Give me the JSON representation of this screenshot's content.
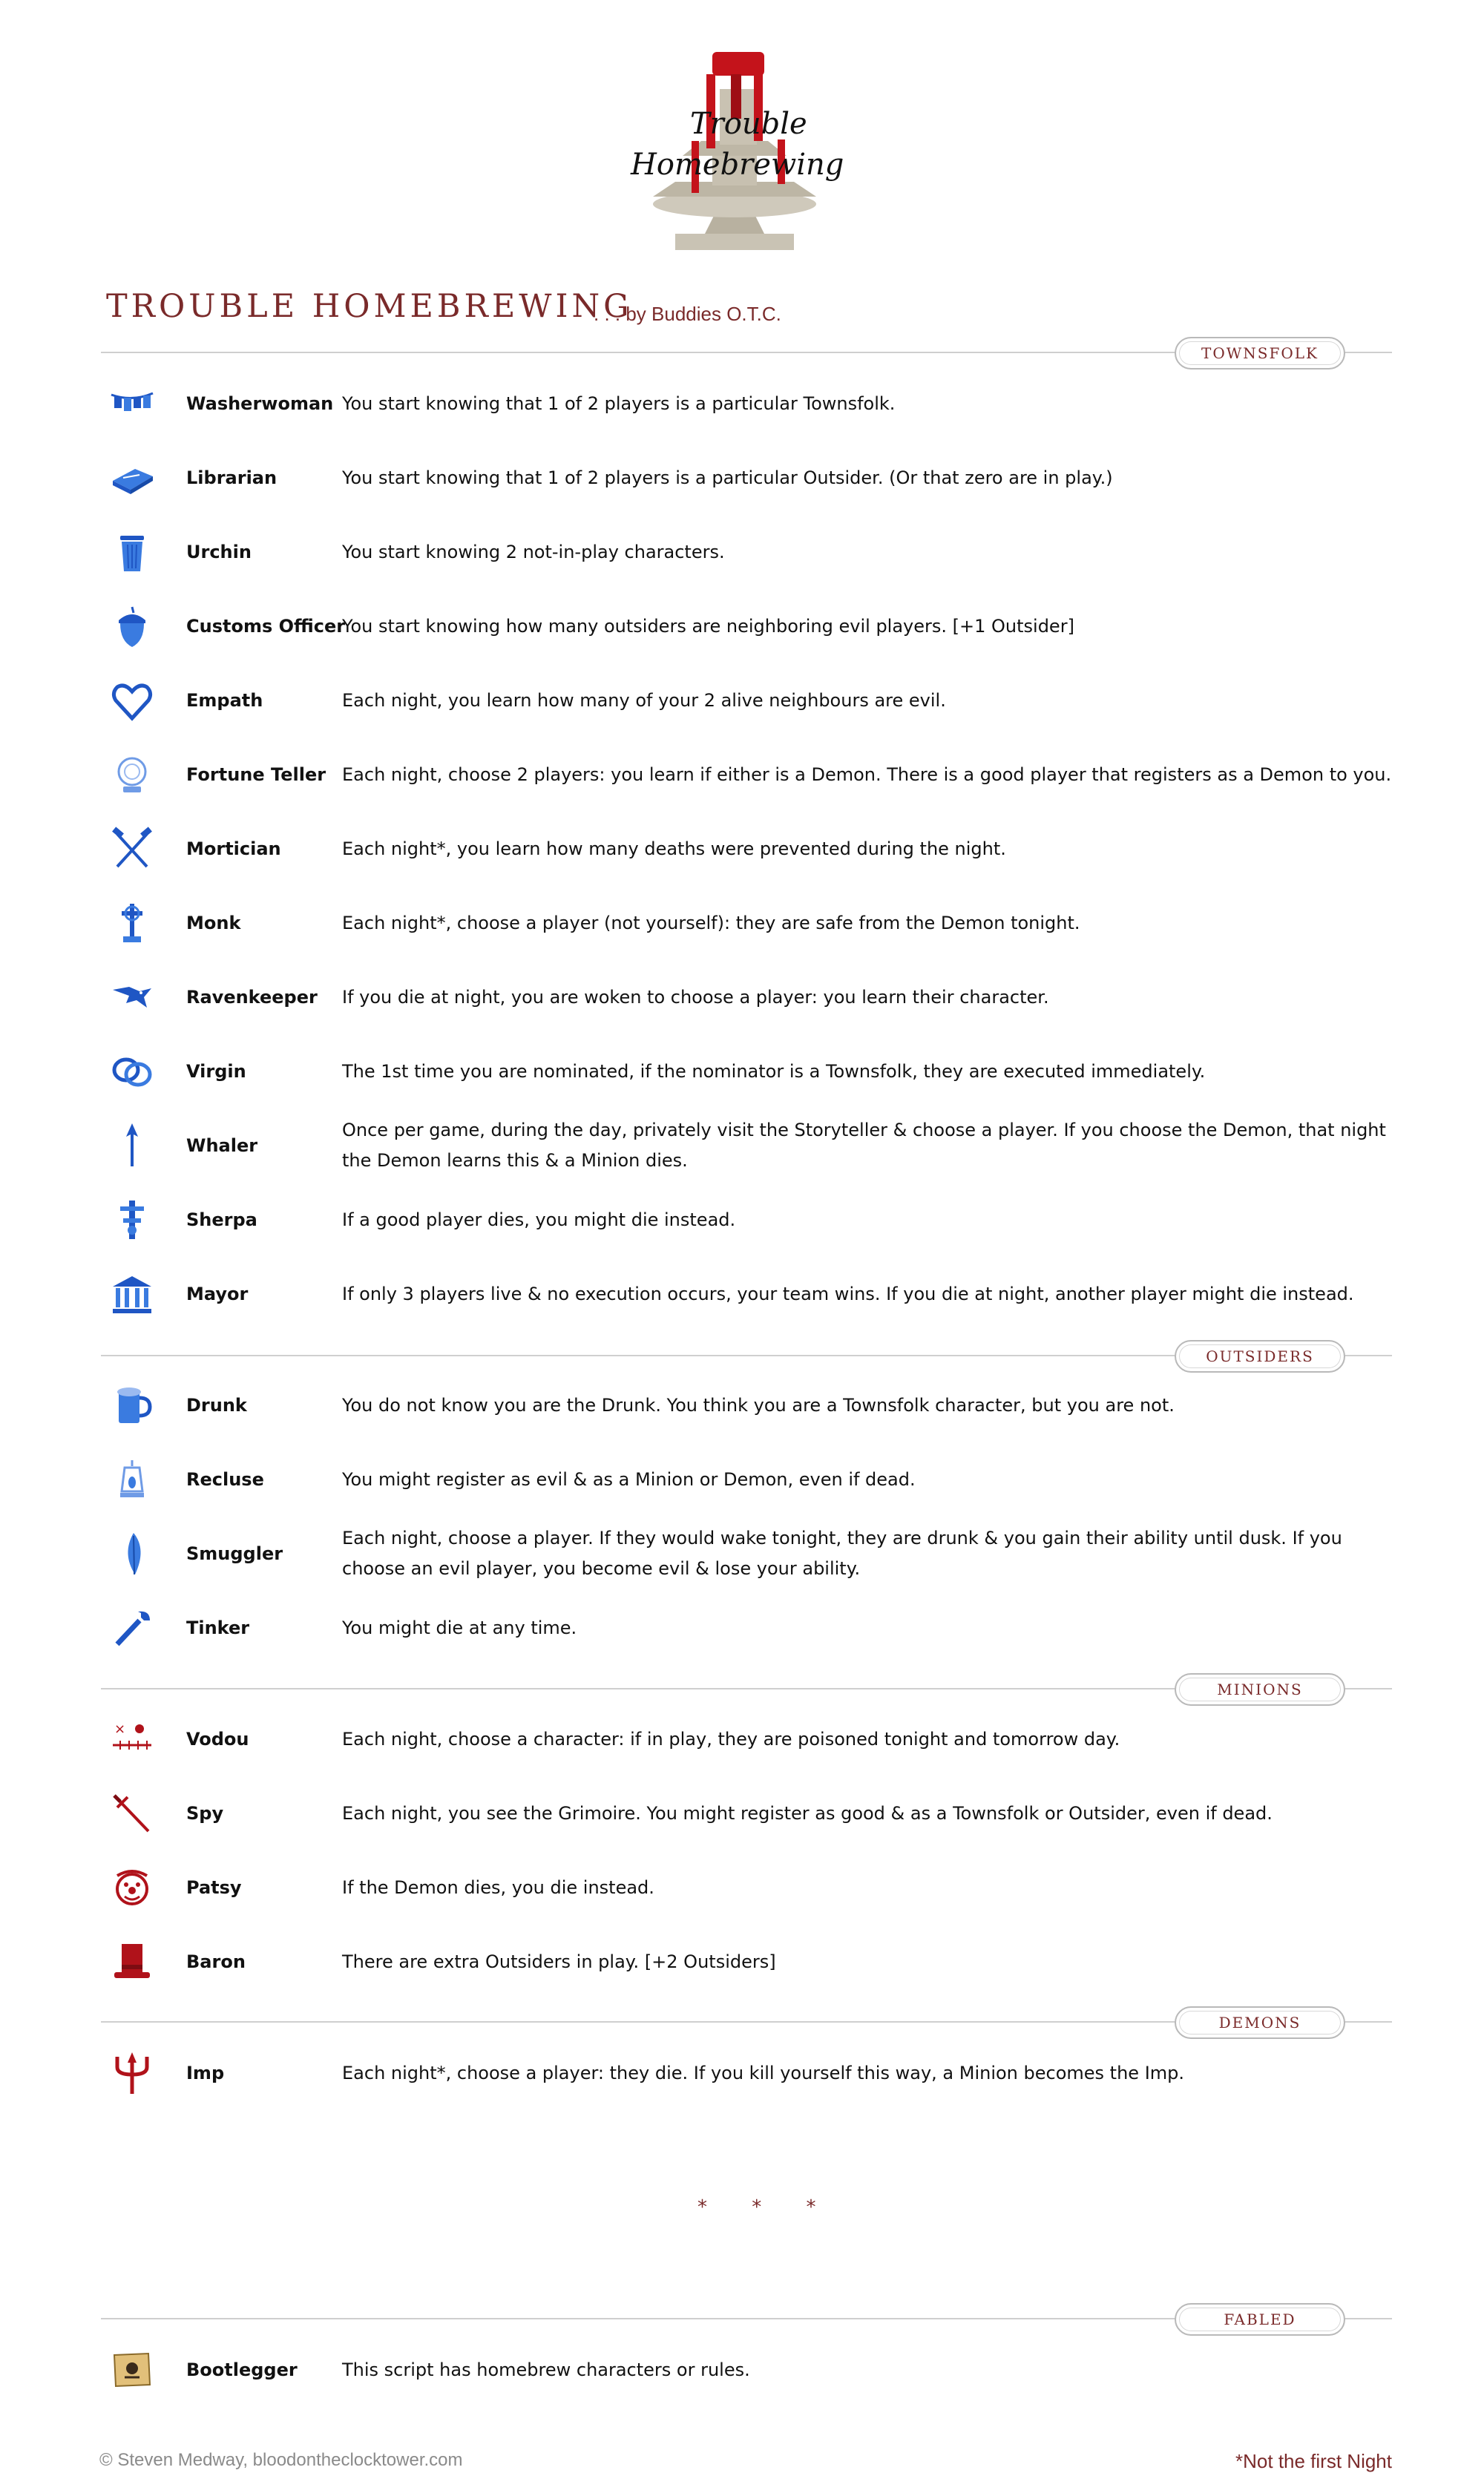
{
  "header": {
    "title": "Trouble Homebrewing",
    "author": ". . . by Buddies O.T.C.",
    "logo_text_line1": "Trouble",
    "logo_text_line2": "Homebrewing"
  },
  "colors": {
    "accent": "#7a2a2a",
    "good_icon": "#1f56c4",
    "evil_icon": "#b0121a"
  },
  "sections": {
    "townsfolk": "Townsfolk",
    "outsiders": "Outsiders",
    "minions": "Minions",
    "demons": "Demons",
    "fabled": "Fabled"
  },
  "townsfolk": [
    {
      "name": "Washerwoman",
      "icon": "clothesline-icon",
      "ability": "You start knowing that 1 of 2 players is a particular Townsfolk."
    },
    {
      "name": "Librarian",
      "icon": "book-icon",
      "ability": "You start knowing that 1 of 2 players is a particular Outsider. (Or that zero are in play.)"
    },
    {
      "name": "Urchin",
      "icon": "trash-can-icon",
      "ability": "You start knowing 2 not-in-play characters."
    },
    {
      "name": "Customs Officer",
      "icon": "acorn-icon",
      "ability": "You start knowing how many outsiders are neighboring evil players. [+1 Outsider]"
    },
    {
      "name": "Empath",
      "icon": "heart-icon",
      "ability": "Each night, you learn how many of your 2 alive neighbours are evil."
    },
    {
      "name": "Fortune Teller",
      "icon": "crystal-ball-icon",
      "ability": "Each night, choose 2 players: you learn if either is a Demon. There is a good player that registers as a Demon to you."
    },
    {
      "name": "Mortician",
      "icon": "crossed-tools-icon",
      "ability": "Each night*, you learn how many deaths were prevented during the night."
    },
    {
      "name": "Monk",
      "icon": "celtic-cross-icon",
      "ability": "Each night*, choose a player (not yourself): they are safe from the Demon tonight."
    },
    {
      "name": "Ravenkeeper",
      "icon": "raven-icon",
      "ability": "If you die at night, you are woken to choose a player: you learn their character."
    },
    {
      "name": "Virgin",
      "icon": "rings-icon",
      "ability": "The 1st time you are nominated, if the nominator is a Townsfolk, they are executed immediately."
    },
    {
      "name": "Whaler",
      "icon": "harpoon-icon",
      "ability": "Once per game, during the day, privately visit the Storyteller & choose a player. If you choose the Demon, that night the Demon learns this & a Minion dies."
    },
    {
      "name": "Sherpa",
      "icon": "totem-icon",
      "ability": "If a good player dies, you might die instead."
    },
    {
      "name": "Mayor",
      "icon": "town-hall-icon",
      "ability": "If only 3 players live & no execution occurs, your team wins. If you die at night, another player might die instead."
    }
  ],
  "outsiders": [
    {
      "name": "Drunk",
      "icon": "tankard-icon",
      "ability": "You do not know you are the Drunk. You think you are a Townsfolk character, but you are not."
    },
    {
      "name": "Recluse",
      "icon": "lantern-icon",
      "ability": "You might register as evil & as a Minion or Demon, even if dead."
    },
    {
      "name": "Smuggler",
      "icon": "feather-icon",
      "ability": "Each night, choose a player. If they would wake tonight, they are drunk & you gain their ability until dusk. If you choose an evil player, you become evil & lose your ability."
    },
    {
      "name": "Tinker",
      "icon": "wrench-icon",
      "ability": "You might die at any time."
    }
  ],
  "minions": [
    {
      "name": "Vodou",
      "icon": "voodoo-doll-icon",
      "ability": "Each night, choose a character: if in play, they are poisoned tonight and tomorrow day."
    },
    {
      "name": "Spy",
      "icon": "dagger-icon",
      "ability": "Each night, you see the Grimoire. You might register as good & as a Townsfolk or Outsider, even if dead."
    },
    {
      "name": "Patsy",
      "icon": "clown-icon",
      "ability": "If the Demon dies, you die instead."
    },
    {
      "name": "Baron",
      "icon": "top-hat-icon",
      "ability": "There are extra Outsiders in play. [+2 Outsiders]"
    }
  ],
  "demons": [
    {
      "name": "Imp",
      "icon": "trident-icon",
      "ability": "Each night*, choose a player: they die. If you kill yourself this way, a Minion becomes the Imp."
    }
  ],
  "separator": "* * *",
  "fabled": [
    {
      "name": "Bootlegger",
      "icon": "treasure-map-icon",
      "ability": "This script has homebrew characters or rules."
    }
  ],
  "footer": {
    "copyright": "© Steven Medway, bloodontheclocktower.com",
    "note": "*Not the first Night"
  }
}
